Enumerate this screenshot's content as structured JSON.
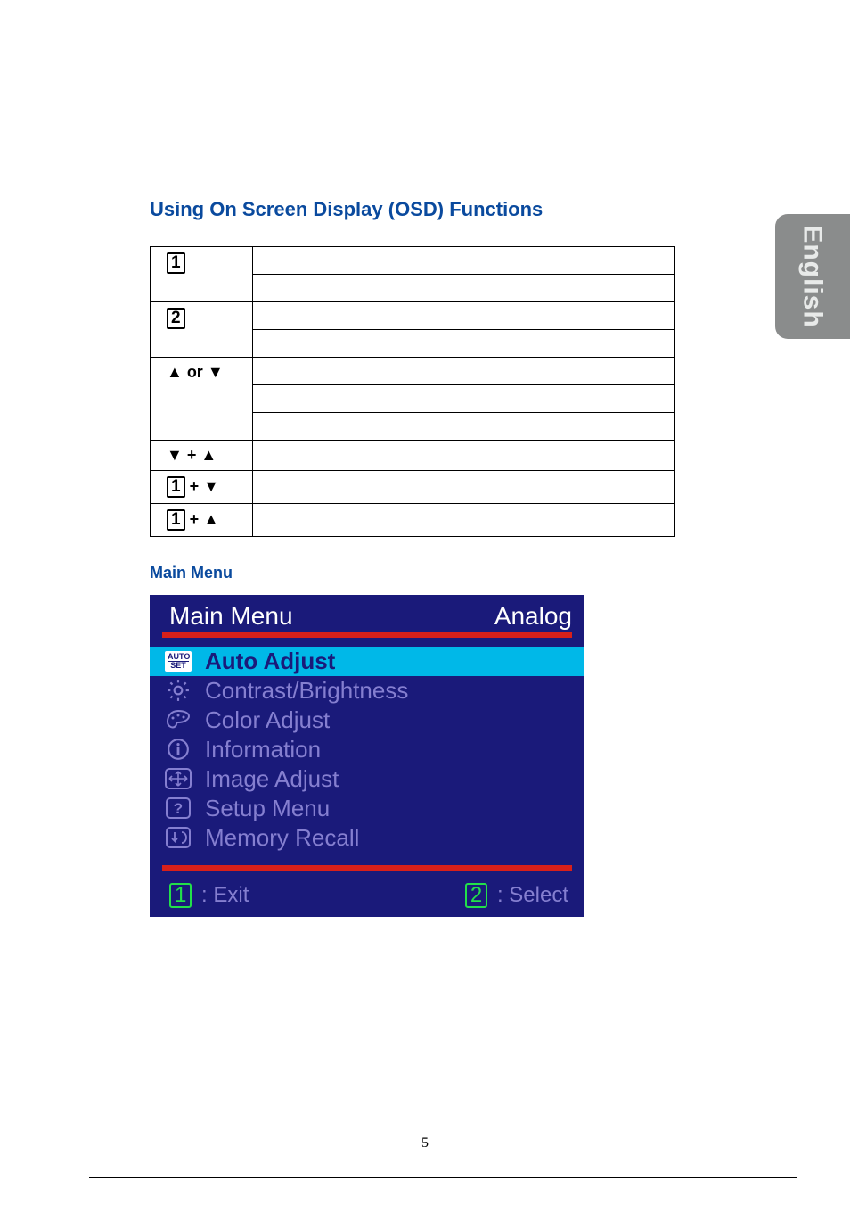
{
  "side_tab": "English",
  "heading": "Using On Screen Display (OSD) Functions",
  "keytable": {
    "row1": {
      "key": "1",
      "content": ""
    },
    "row2": {
      "key": "2",
      "content": ""
    },
    "row3": {
      "key": "▲ or ▼",
      "content": ""
    },
    "row4": {
      "key": "▼ + ▲",
      "content": ""
    },
    "row5": {
      "key_prefix": "1",
      "key_suffix": " + ▼",
      "content": ""
    },
    "row6": {
      "key_prefix": "1",
      "key_suffix": " + ▲",
      "content": ""
    }
  },
  "submenu_title": "Main Menu",
  "osd": {
    "title_left": "Main Menu",
    "title_right": "Analog",
    "items": [
      {
        "icon": "autoset",
        "label": "Auto Adjust",
        "highlight": true
      },
      {
        "icon": "sun",
        "label": "Contrast/Brightness"
      },
      {
        "icon": "palette",
        "label": "Color Adjust"
      },
      {
        "icon": "info",
        "label": "Information"
      },
      {
        "icon": "arrows",
        "label": "Image Adjust"
      },
      {
        "icon": "question",
        "label": "Setup Menu"
      },
      {
        "icon": "recall",
        "label": "Memory Recall"
      }
    ],
    "footer_left_num": "1",
    "footer_left_label": ": Exit",
    "footer_right_num": "2",
    "footer_right_label": ": Select"
  },
  "page_number": "5"
}
